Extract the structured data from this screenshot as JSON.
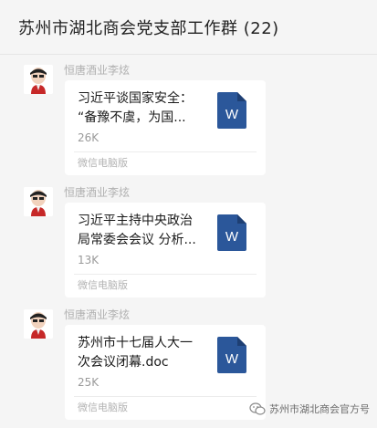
{
  "header": {
    "title": "苏州市湖北商会党支部工作群 (22)"
  },
  "messages": [
    {
      "sender": "恒唐酒业李炫",
      "file": {
        "title": "习近平谈国家安全：\n“备豫不虞，为国...",
        "size": "26K",
        "source": "微信电脑版",
        "icon": "word-doc-icon",
        "icon_letter": "W"
      }
    },
    {
      "sender": "恒唐酒业李炫",
      "file": {
        "title": "习近平主持中央政治\n局常委会会议 分析...",
        "size": "13K",
        "source": "微信电脑版",
        "icon": "word-doc-icon",
        "icon_letter": "W"
      }
    },
    {
      "sender": "恒唐酒业李炫",
      "file": {
        "title": "苏州市十七届人大一\n次会议闭幕.doc",
        "size": "25K",
        "source": "微信电脑版",
        "icon": "word-doc-icon",
        "icon_letter": "W"
      }
    }
  ],
  "watermark": {
    "text": "苏州市湖北商会官方号",
    "icon": "wechat-official-account-icon"
  },
  "colors": {
    "background": "#f5f5f5",
    "card": "#ffffff",
    "word_blue": "#2b579a",
    "word_blue_dark": "#1e3f73"
  }
}
